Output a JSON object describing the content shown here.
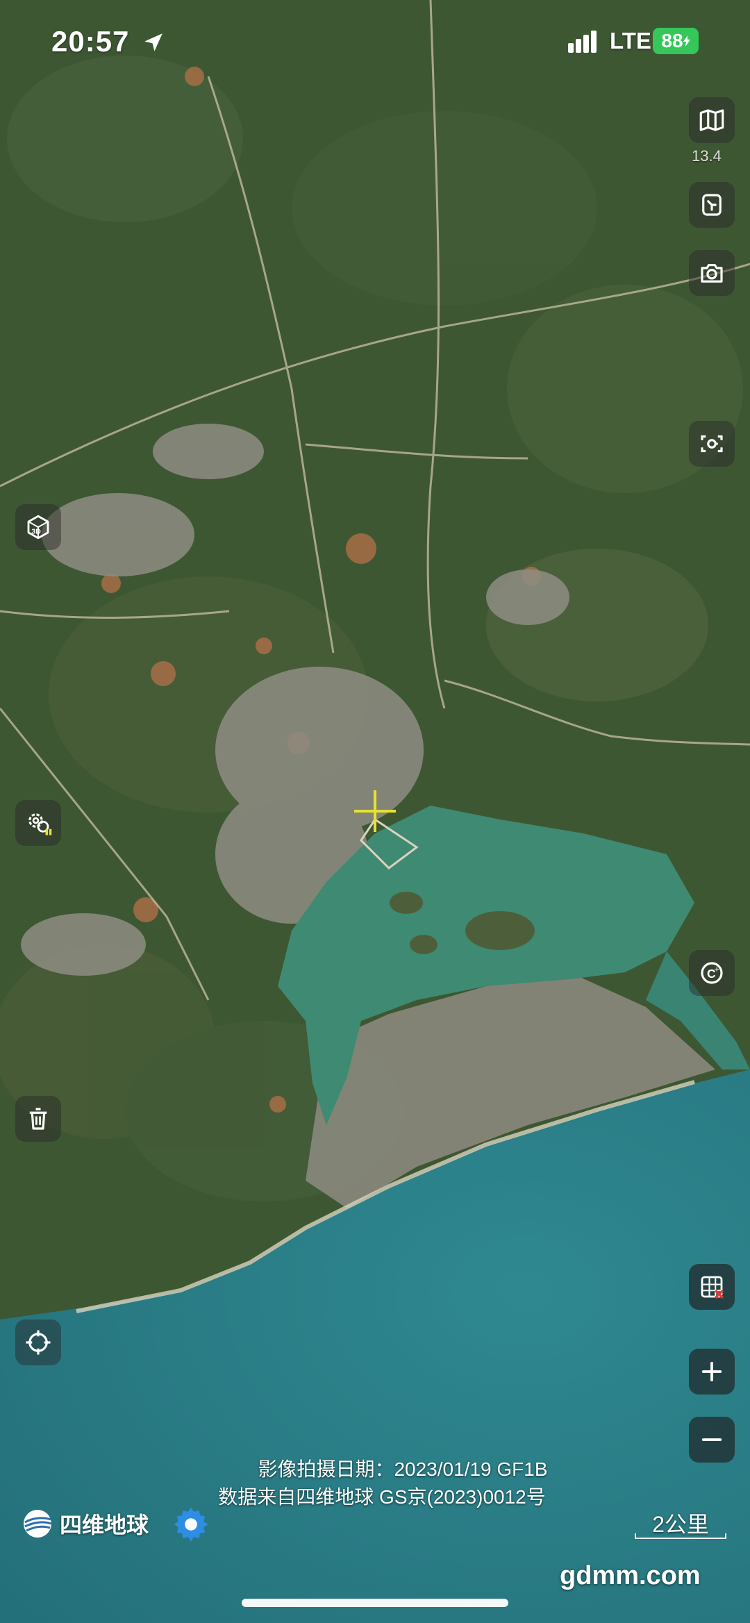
{
  "status_bar": {
    "time": "20:57",
    "network": "LTE",
    "battery": "88"
  },
  "map": {
    "type": "satellite",
    "zoom_level": "13.4"
  },
  "controls": {
    "right": [
      "map-layers-icon",
      "bookmark-icon",
      "camera-icon",
      "screenshot-icon",
      "coordinate-icon",
      "no-grid-icon",
      "zoom-in-icon",
      "zoom-out-icon"
    ],
    "left": [
      "3d-icon",
      "gear-layers-icon",
      "trash-icon",
      "locate-icon"
    ]
  },
  "credits": {
    "line1": "影像拍摄日期：2023/01/19 GF1B",
    "line2": "数据来自四维地球 GS京(2023)0012号"
  },
  "brand": {
    "name": "四维地球"
  },
  "scale": {
    "label": "2公里"
  },
  "watermark": "gdmm.com",
  "colors": {
    "land": "#3f5a34",
    "sea": "#2b7f86",
    "lagoon": "#3f8a72",
    "city": "#9a9a8f",
    "crosshair": "#e6e233",
    "battery": "#35c759",
    "gear": "#2f8de4"
  }
}
